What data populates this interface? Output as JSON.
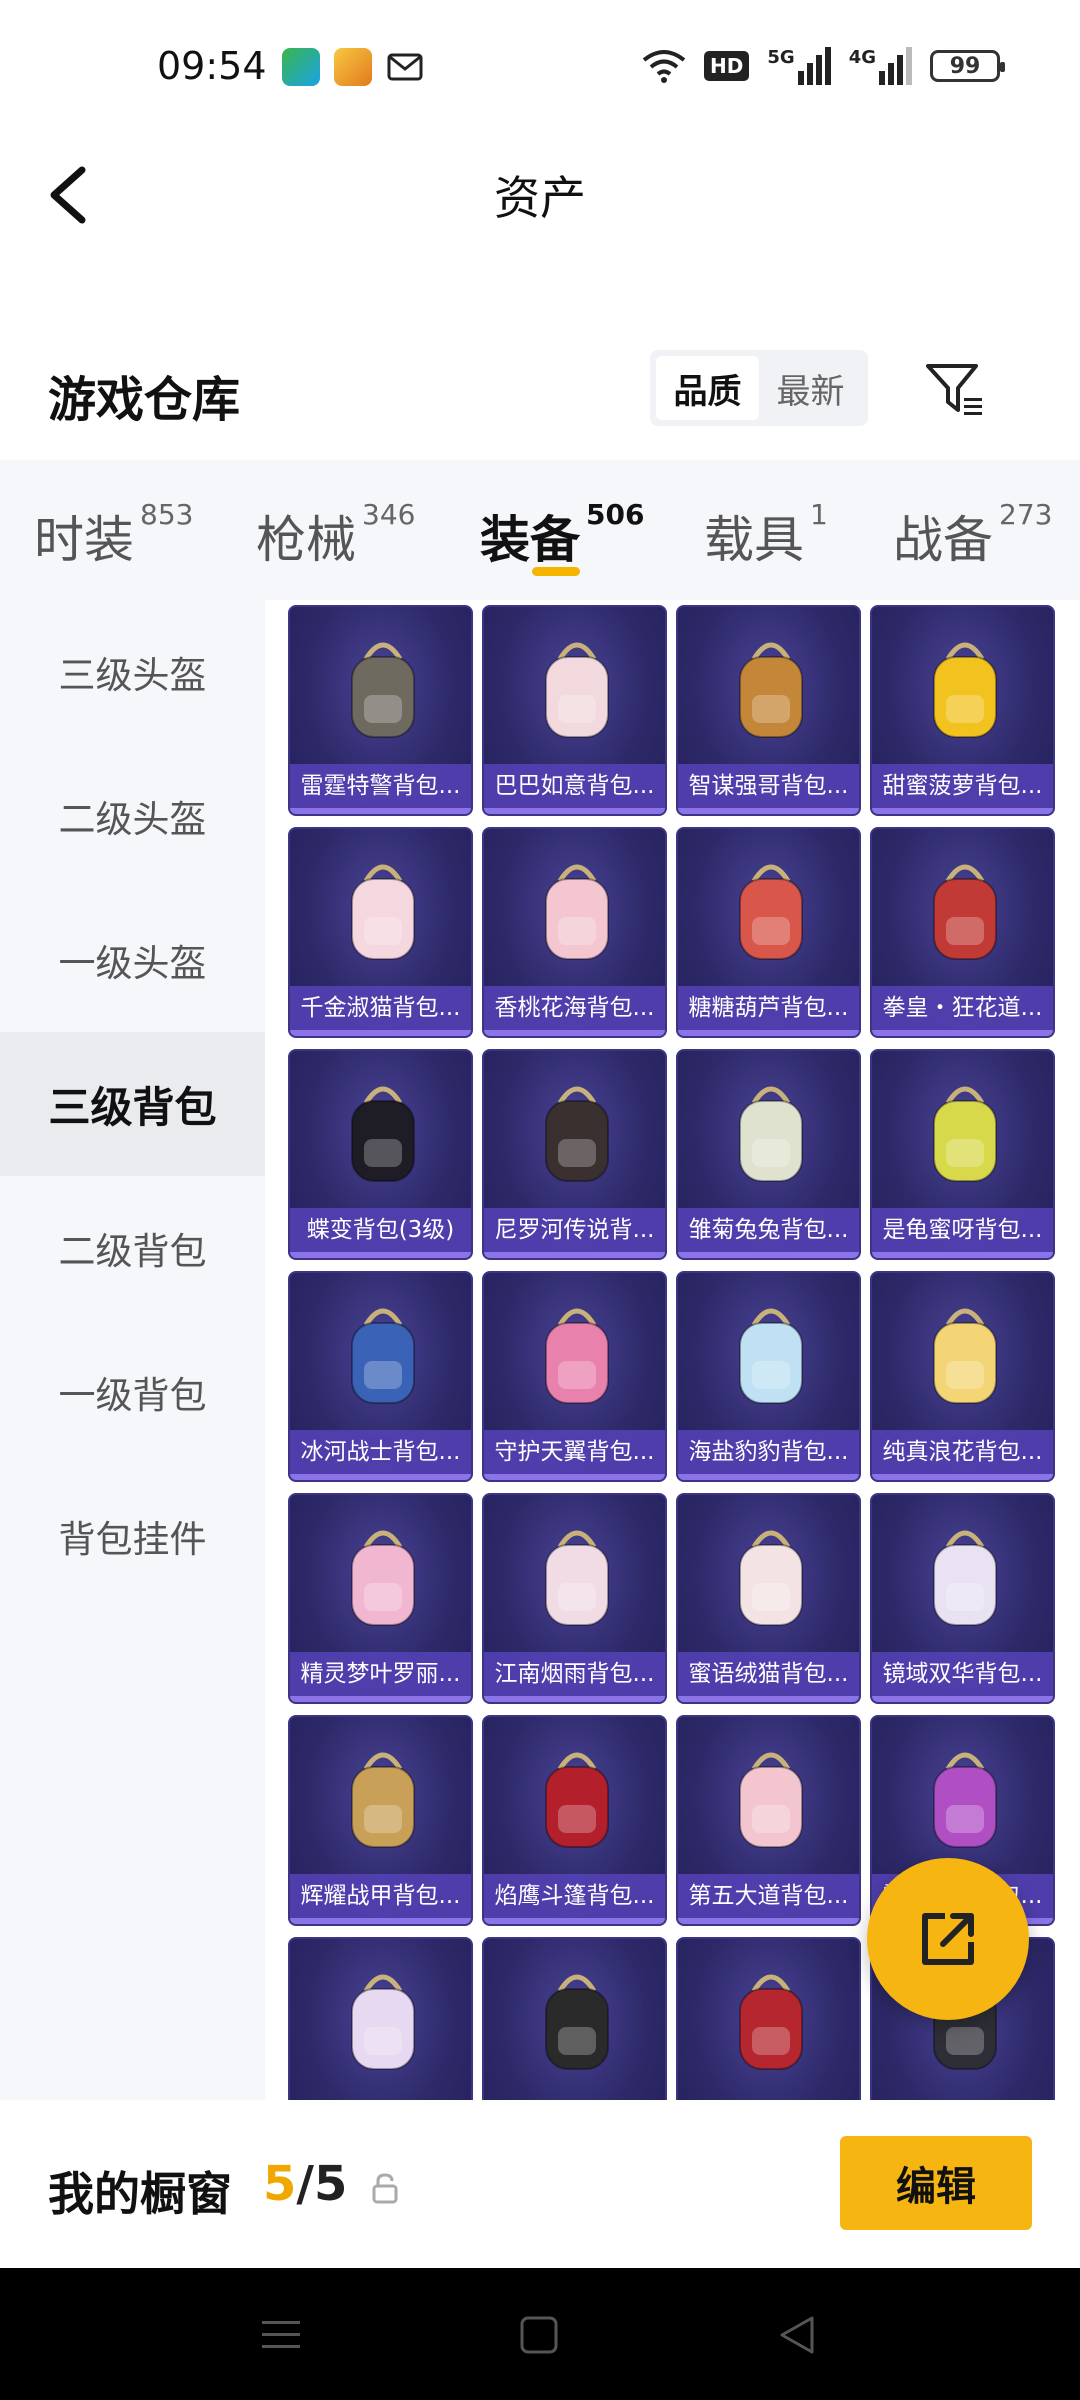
{
  "status_bar": {
    "time": "09:54",
    "network_badge": "HD",
    "signal_1": "5G",
    "signal_2": "4G",
    "battery": "99"
  },
  "header": {
    "title": "资产"
  },
  "section": {
    "title": "游戏仓库",
    "sort_options": [
      "品质",
      "最新"
    ],
    "active_sort": "品质"
  },
  "tabs": [
    {
      "label": "时装",
      "count": "853"
    },
    {
      "label": "枪械",
      "count": "346"
    },
    {
      "label": "装备",
      "count": "506"
    },
    {
      "label": "载具",
      "count": "1"
    },
    {
      "label": "战备",
      "count": "273"
    }
  ],
  "active_tab": "装备",
  "sidebar": {
    "items": [
      "三级头盔",
      "二级头盔",
      "一级头盔",
      "三级背包",
      "二级背包",
      "一级背包",
      "背包挂件"
    ],
    "active": "三级背包"
  },
  "items": [
    {
      "name": "雷霆特警背包...",
      "color": "#6f6a60"
    },
    {
      "name": "巴巴如意背包...",
      "color": "#f2d9dd"
    },
    {
      "name": "智谋强哥背包...",
      "color": "#c4873a"
    },
    {
      "name": "甜蜜菠萝背包...",
      "color": "#f2c31f"
    },
    {
      "name": "千金淑猫背包...",
      "color": "#f4d7df"
    },
    {
      "name": "香桃花海背包...",
      "color": "#f3c6d0"
    },
    {
      "name": "糖糖葫芦背包...",
      "color": "#d8564a"
    },
    {
      "name": "拳皇・狂花道...",
      "color": "#c23a36"
    },
    {
      "name": "蝶变背包(3级)",
      "color": "#1e1c24"
    },
    {
      "name": "尼罗河传说背...",
      "color": "#3a3030"
    },
    {
      "name": "雏菊兔兔背包...",
      "color": "#dfe2cf"
    },
    {
      "name": "是龟蜜呀背包...",
      "color": "#d7d84a"
    },
    {
      "name": "冰河战士背包...",
      "color": "#3a63b8"
    },
    {
      "name": "守护天翼背包...",
      "color": "#e882ad"
    },
    {
      "name": "海盐豹豹背包...",
      "color": "#bfe1f3"
    },
    {
      "name": "纯真浪花背包...",
      "color": "#f3d575"
    },
    {
      "name": "精灵梦叶罗丽...",
      "color": "#f1b7d1"
    },
    {
      "name": "江南烟雨背包...",
      "color": "#f1dbe4"
    },
    {
      "name": "蜜语绒猫背包...",
      "color": "#f4e3e5"
    },
    {
      "name": "镜域双华背包...",
      "color": "#e9e2f3"
    },
    {
      "name": "辉耀战甲背包...",
      "color": "#c9a058"
    },
    {
      "name": "焰鹰斗篷背包...",
      "color": "#b3202c"
    },
    {
      "name": "第五大道背包...",
      "color": "#f3c6cf"
    },
    {
      "name": "霓虹都市背包...",
      "color": "#b04fc4"
    },
    {
      "name": "",
      "color": "#e7d9f1"
    },
    {
      "name": "",
      "color": "#2a2a2a"
    },
    {
      "name": "",
      "color": "#b5262e"
    },
    {
      "name": "",
      "color": "#2e2e36"
    }
  ],
  "showcase": {
    "title": "我的橱窗",
    "used": "5",
    "separator": "/",
    "total": "5",
    "edit_label": "编辑"
  },
  "colors": {
    "accent": "#f7b512",
    "card_bg": "#2e2a6a",
    "card_label_bg": "#5642b9"
  }
}
